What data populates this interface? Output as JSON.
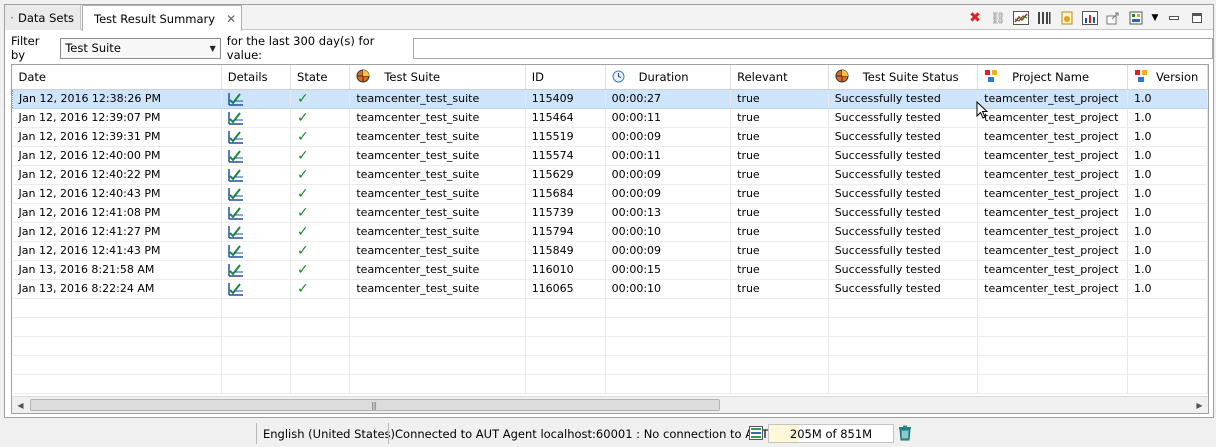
{
  "tabs": [
    {
      "label": "Data Sets",
      "active": false
    },
    {
      "label": "Test Result Summary",
      "active": true
    }
  ],
  "toolbar_icons": [
    "delete-red-x-icon",
    "refresh-chain-icon",
    "chart-icon",
    "columns-icon",
    "export-icon",
    "compare-chart-icon",
    "share-icon",
    "config-icon",
    "view-menu-icon",
    "minimize-icon",
    "maximize-icon"
  ],
  "filter": {
    "label": "Filter by",
    "selected": "Test Suite",
    "suffix": "for the last 300 day(s) for value:",
    "value": ""
  },
  "table": {
    "columns": [
      "Date",
      "Details",
      "State",
      "Test Suite",
      "ID",
      "Duration",
      "Relevant",
      "Test Suite Status",
      "Project Name",
      "Version"
    ],
    "rows": [
      {
        "date": "Jan 12, 2016 12:38:26 PM",
        "suite": "teamcenter_test_suite",
        "id": "115409",
        "duration": "00:00:27",
        "relevant": "true",
        "status": "Successfully tested",
        "project": "teamcenter_test_project",
        "version": "1.0",
        "selected": true
      },
      {
        "date": "Jan 12, 2016 12:39:07 PM",
        "suite": "teamcenter_test_suite",
        "id": "115464",
        "duration": "00:00:11",
        "relevant": "true",
        "status": "Successfully tested",
        "project": "teamcenter_test_project",
        "version": "1.0"
      },
      {
        "date": "Jan 12, 2016 12:39:31 PM",
        "suite": "teamcenter_test_suite",
        "id": "115519",
        "duration": "00:00:09",
        "relevant": "true",
        "status": "Successfully tested",
        "project": "teamcenter_test_project",
        "version": "1.0"
      },
      {
        "date": "Jan 12, 2016 12:40:00 PM",
        "suite": "teamcenter_test_suite",
        "id": "115574",
        "duration": "00:00:11",
        "relevant": "true",
        "status": "Successfully tested",
        "project": "teamcenter_test_project",
        "version": "1.0"
      },
      {
        "date": "Jan 12, 2016 12:40:22 PM",
        "suite": "teamcenter_test_suite",
        "id": "115629",
        "duration": "00:00:09",
        "relevant": "true",
        "status": "Successfully tested",
        "project": "teamcenter_test_project",
        "version": "1.0"
      },
      {
        "date": "Jan 12, 2016 12:40:43 PM",
        "suite": "teamcenter_test_suite",
        "id": "115684",
        "duration": "00:00:09",
        "relevant": "true",
        "status": "Successfully tested",
        "project": "teamcenter_test_project",
        "version": "1.0"
      },
      {
        "date": "Jan 12, 2016 12:41:08 PM",
        "suite": "teamcenter_test_suite",
        "id": "115739",
        "duration": "00:00:13",
        "relevant": "true",
        "status": "Successfully tested",
        "project": "teamcenter_test_project",
        "version": "1.0"
      },
      {
        "date": "Jan 12, 2016 12:41:27 PM",
        "suite": "teamcenter_test_suite",
        "id": "115794",
        "duration": "00:00:10",
        "relevant": "true",
        "status": "Successfully tested",
        "project": "teamcenter_test_project",
        "version": "1.0"
      },
      {
        "date": "Jan 12, 2016 12:41:43 PM",
        "suite": "teamcenter_test_suite",
        "id": "115849",
        "duration": "00:00:09",
        "relevant": "true",
        "status": "Successfully tested",
        "project": "teamcenter_test_project",
        "version": "1.0"
      },
      {
        "date": "Jan 13, 2016 8:21:58 AM",
        "suite": "teamcenter_test_suite",
        "id": "116010",
        "duration": "00:00:15",
        "relevant": "true",
        "status": "Successfully tested",
        "project": "teamcenter_test_project",
        "version": "1.0"
      },
      {
        "date": "Jan 13, 2016 8:22:24 AM",
        "suite": "teamcenter_test_suite",
        "id": "116065",
        "duration": "00:00:10",
        "relevant": "true",
        "status": "Successfully tested",
        "project": "teamcenter_test_project",
        "version": "1.0"
      }
    ],
    "state_icon": "checkmark-icon",
    "details_icon": "details-chart-icon",
    "empty_row_count": 5
  },
  "statusbar": {
    "locale": "English (United States)",
    "connection": "Connected to AUT Agent localhost:60001 : No connection to AUT",
    "memory": "205M of 851M",
    "memory_used_fraction": 0.24
  },
  "colors": {
    "selection": "#cde4fb",
    "check_green": "#1a8a2a",
    "delete_red": "#e02020"
  }
}
